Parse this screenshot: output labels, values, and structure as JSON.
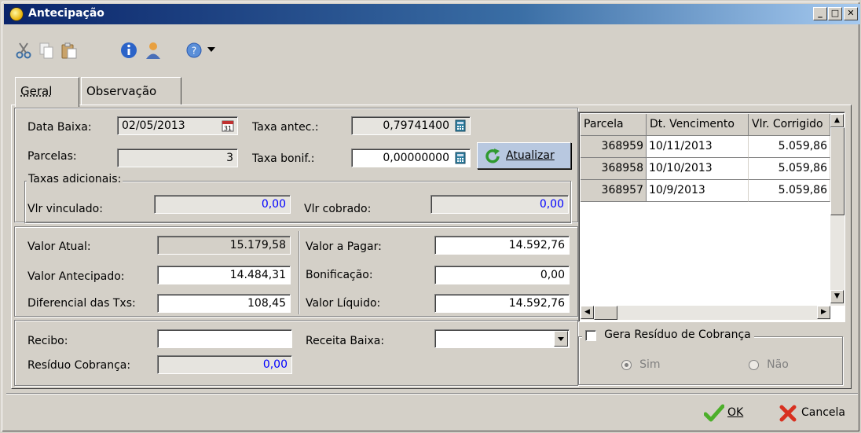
{
  "window": {
    "title": "Antecipação"
  },
  "toolbar": {
    "icons": [
      "cut-icon",
      "copy-icon",
      "paste-icon",
      "info-icon",
      "user-icon",
      "help-icon"
    ]
  },
  "tabs": [
    {
      "label": "Geral"
    },
    {
      "label": "Observação"
    }
  ],
  "form": {
    "data_baixa_label": "Data Baixa:",
    "data_baixa_value": "02/05/2013",
    "taxa_antec_label": "Taxa antec.:",
    "taxa_antec_value": "0,79741400",
    "parcelas_label": "Parcelas:",
    "parcelas_value": "3",
    "taxa_bonif_label": "Taxa bonif.:",
    "taxa_bonif_value": "0,00000000",
    "atualizar_label": "Atualizar",
    "taxas_adicionais_label": "Taxas adicionais:",
    "vlr_vinculado_label": "Vlr vinculado:",
    "vlr_vinculado_value": "0,00",
    "vlr_cobrado_label": "Vlr cobrado:",
    "vlr_cobrado_value": "0,00",
    "valor_atual_label": "Valor Atual:",
    "valor_atual_value": "15.179,58",
    "valor_antecipado_label": "Valor Antecipado:",
    "valor_antecipado_value": "14.484,31",
    "diferencial_label": "Diferencial das Txs:",
    "diferencial_value": "108,45",
    "valor_pagar_label": "Valor a Pagar:",
    "valor_pagar_value": "14.592,76",
    "bonificacao_label": "Bonificação:",
    "bonificacao_value": "0,00",
    "valor_liquido_label": "Valor Líquido:",
    "valor_liquido_value": "14.592,76",
    "recibo_label": "Recibo:",
    "recibo_value": "",
    "receita_baixa_label": "Receita Baixa:",
    "receita_baixa_value": "",
    "residuo_label": "Resíduo Cobrança:",
    "residuo_value": "0,00"
  },
  "grid": {
    "columns": [
      "Parcela",
      "Dt. Vencimento",
      "Vlr. Corrigido"
    ],
    "rows": [
      [
        "368959",
        "10/11/2013",
        "5.059,86"
      ],
      [
        "368958",
        "10/10/2013",
        "5.059,86"
      ],
      [
        "368957",
        "10/9/2013",
        "5.059,86"
      ]
    ]
  },
  "residuo_group": {
    "checkbox_label": "Gera Resíduo de Cobrança",
    "sim_label": "Sim",
    "nao_label": "Não"
  },
  "footer": {
    "ok_label": "OK",
    "cancel_label": "Cancela"
  },
  "colors": {
    "title_bar": "#0a246a",
    "blue_value": "#0000ff",
    "window_bg": "#d4d0c8"
  }
}
